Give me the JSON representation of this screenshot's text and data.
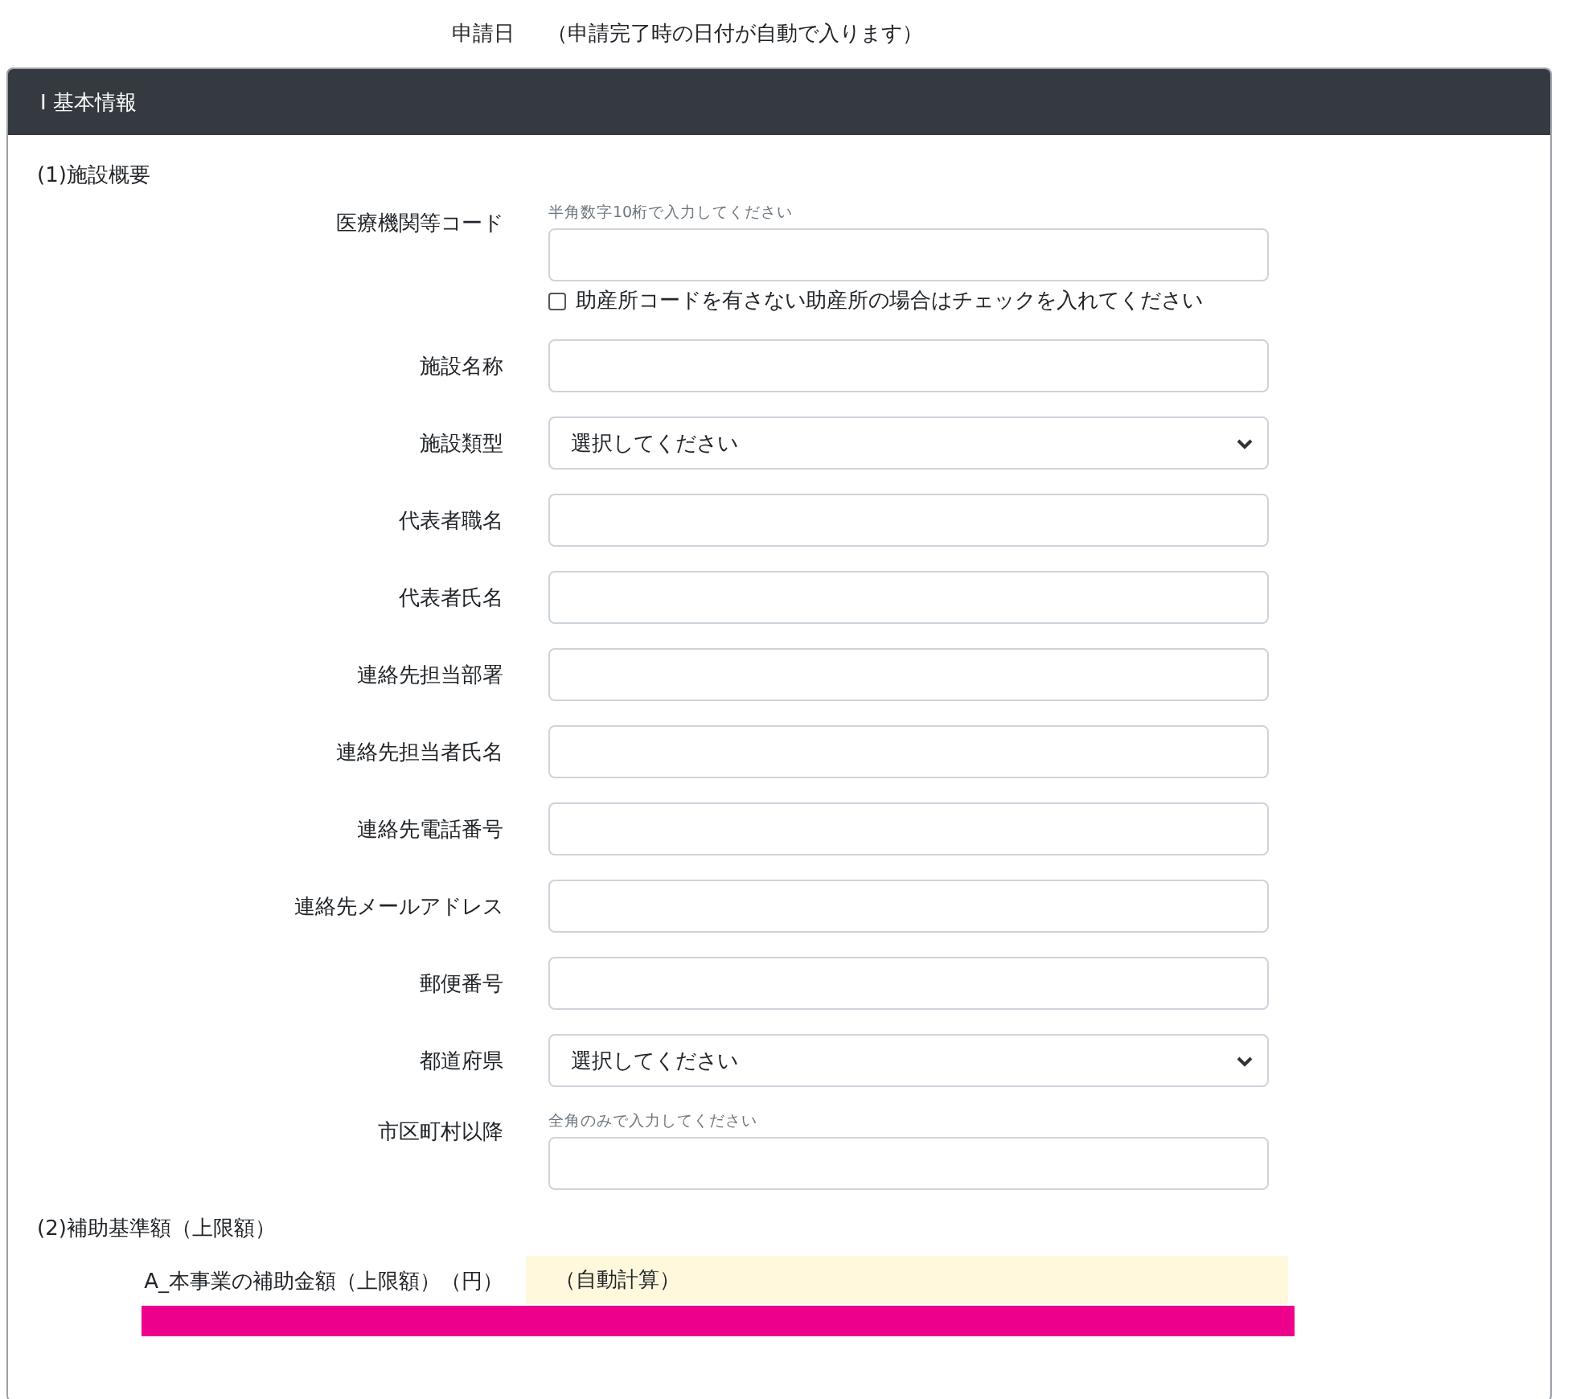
{
  "application_date": {
    "label": "申請日",
    "value": "（申請完了時の日付が自動で入ります）"
  },
  "section": {
    "title": "Ⅰ 基本情報",
    "groups": [
      {
        "title": "(1)施設概要",
        "fields": [
          {
            "label": "医療機関等コード",
            "kind": "text",
            "hint": "半角数字10桁で入力してください",
            "checkbox": {
              "label": "助産所コードを有さない助産所の場合はチェックを入れてください",
              "checked": false
            }
          },
          {
            "label": "施設名称",
            "kind": "text"
          },
          {
            "label": "施設類型",
            "kind": "select",
            "placeholder": "選択してください"
          },
          {
            "label": "代表者職名",
            "kind": "text"
          },
          {
            "label": "代表者氏名",
            "kind": "text"
          },
          {
            "label": "連絡先担当部署",
            "kind": "text"
          },
          {
            "label": "連絡先担当者氏名",
            "kind": "text"
          },
          {
            "label": "連絡先電話番号",
            "kind": "text"
          },
          {
            "label": "連絡先メールアドレス",
            "kind": "text"
          },
          {
            "label": "郵便番号",
            "kind": "text"
          },
          {
            "label": "都道府県",
            "kind": "select",
            "placeholder": "選択してください"
          },
          {
            "label": "市区町村以降",
            "kind": "text",
            "hint": "全角のみで入力してください"
          }
        ]
      },
      {
        "title": "(2)補助基準額（上限額）",
        "fields": [
          {
            "label": "A_本事業の補助金額（上限額）（円）",
            "kind": "auto",
            "value": "（自動計算）"
          }
        ]
      }
    ]
  }
}
